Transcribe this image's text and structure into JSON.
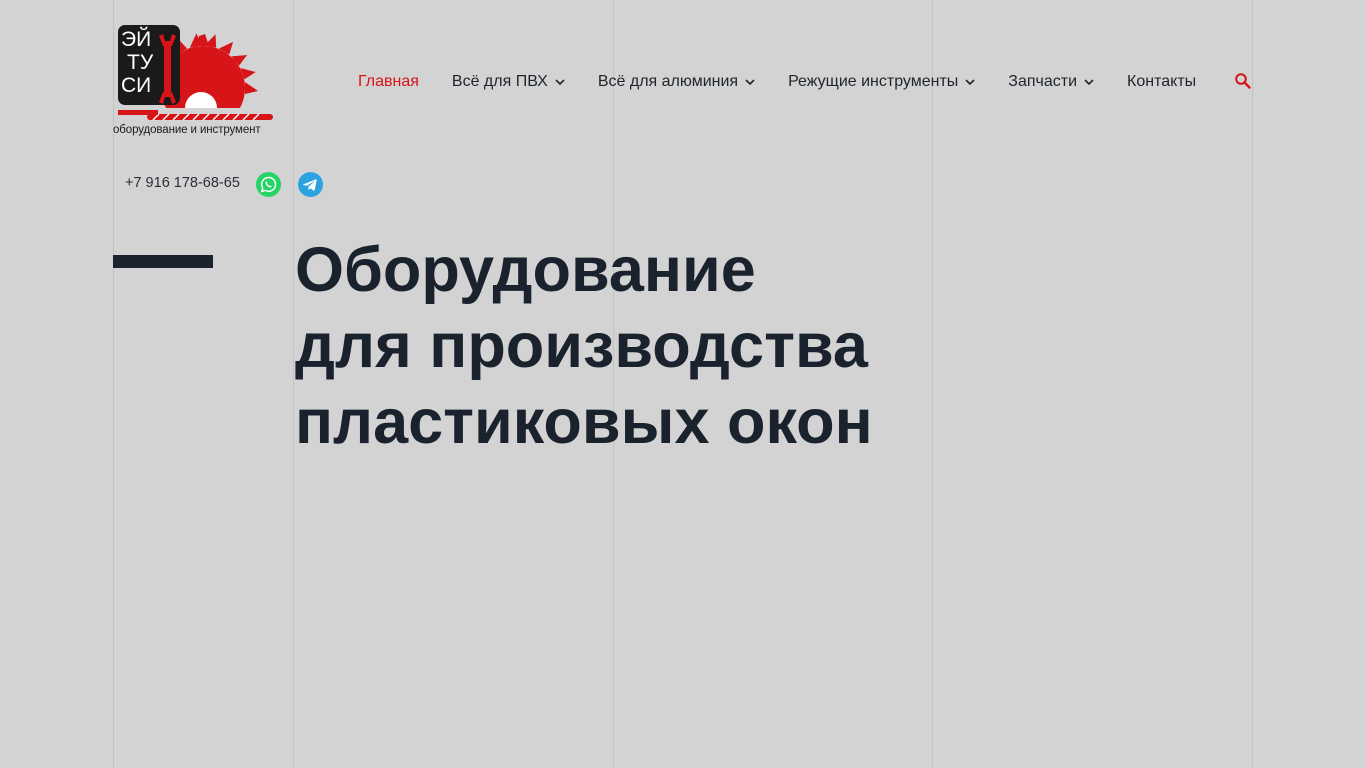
{
  "logo": {
    "mark_lines": [
      "ЭЙ",
      "ТУ",
      "СИ"
    ],
    "caption": "оборудование и инструмент",
    "colors": {
      "red": "#d71418",
      "dark": "#1a1a1a",
      "white": "#ffffff"
    }
  },
  "nav": {
    "items": [
      {
        "label": "Главная",
        "active": true,
        "has_dropdown": false
      },
      {
        "label": "Всё для ПВХ",
        "active": false,
        "has_dropdown": true
      },
      {
        "label": "Всё для алюминия",
        "active": false,
        "has_dropdown": true
      },
      {
        "label": "Режущие инструменты",
        "active": false,
        "has_dropdown": true
      },
      {
        "label": "Запчасти",
        "active": false,
        "has_dropdown": true
      },
      {
        "label": "Контакты",
        "active": false,
        "has_dropdown": false
      }
    ],
    "search_icon": "search-icon"
  },
  "contacts": {
    "phone": "+7 916 178-68-65",
    "messengers": [
      "whatsapp-icon",
      "telegram-icon"
    ]
  },
  "hero": {
    "title_lines": [
      "Оборудование",
      "для производства",
      "пластиковых окон"
    ]
  },
  "colors": {
    "background": "#d3d3d3",
    "accent": "#d71418",
    "text_dark": "#1a222d",
    "whatsapp": "#25d366",
    "telegram": "#2aa3e0"
  }
}
